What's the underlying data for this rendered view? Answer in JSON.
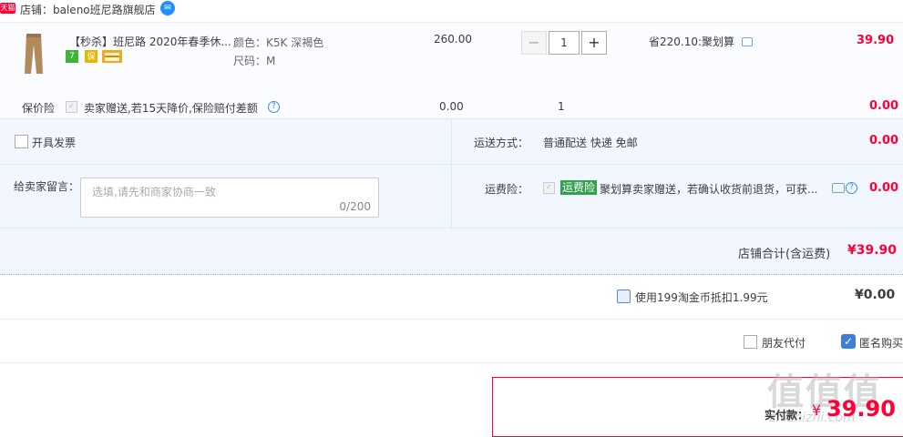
{
  "shop": {
    "badge": "天猫",
    "label": "店铺：baleno班尼路旗舰店",
    "ww_icon": "wangwang-chat-icon"
  },
  "item": {
    "title": "【秒杀】班尼路 2020年春季休...",
    "tags": [
      {
        "text": "7",
        "color": "#3cb43c",
        "icon": "seven-day-return-icon"
      },
      {
        "text": "保",
        "color": "#e6b800",
        "icon": "guarantee-icon"
      },
      {
        "text": "",
        "color": "#f5a623",
        "icon": "card-icon"
      }
    ],
    "sku_color": "颜色：K5K 深褐色",
    "sku_size": "尺码：M",
    "unit_price": "260.00",
    "quantity": "1",
    "qty_minus": "−",
    "qty_plus": "+",
    "promotion": "省220.10:聚划算",
    "total": "39.90"
  },
  "insurance": {
    "label": "保价险",
    "description": "卖家赠送,若15天降价,保险赔付差额",
    "price": "0.00",
    "quantity": "1",
    "total": "0.00"
  },
  "invoice": {
    "label": "开具发票"
  },
  "shipping": {
    "label": "运送方式：",
    "value": "普通配送 快递 免邮",
    "price": "0.00"
  },
  "message": {
    "label": "给卖家留言：",
    "placeholder": "选填,请先和商家协商一致",
    "counter": "0/200"
  },
  "freight_insurance": {
    "label": "运费险：",
    "tag": "运费险",
    "description": "聚划算卖家赠送，若确认收货前退货，可获...",
    "total": "0.00"
  },
  "subtotal": {
    "label": "店铺合计(含运费)",
    "value": "¥39.90"
  },
  "coins": {
    "label": "使用199淘金币抵扣1.99元",
    "value": "¥0.00"
  },
  "friend_pay": {
    "label": "朋友代付"
  },
  "anonymous": {
    "label": "匿名购买",
    "checked": true
  },
  "payment": {
    "label": "实付款：",
    "yen": "¥",
    "value": "39.90"
  },
  "watermark": {
    "logo": "值值值",
    "site": "zhizhizhi.com"
  },
  "colors": {
    "price_red": "#ff0036",
    "panel_bg": "#f2f7ff",
    "accent_blue": "#3d7ed6"
  }
}
